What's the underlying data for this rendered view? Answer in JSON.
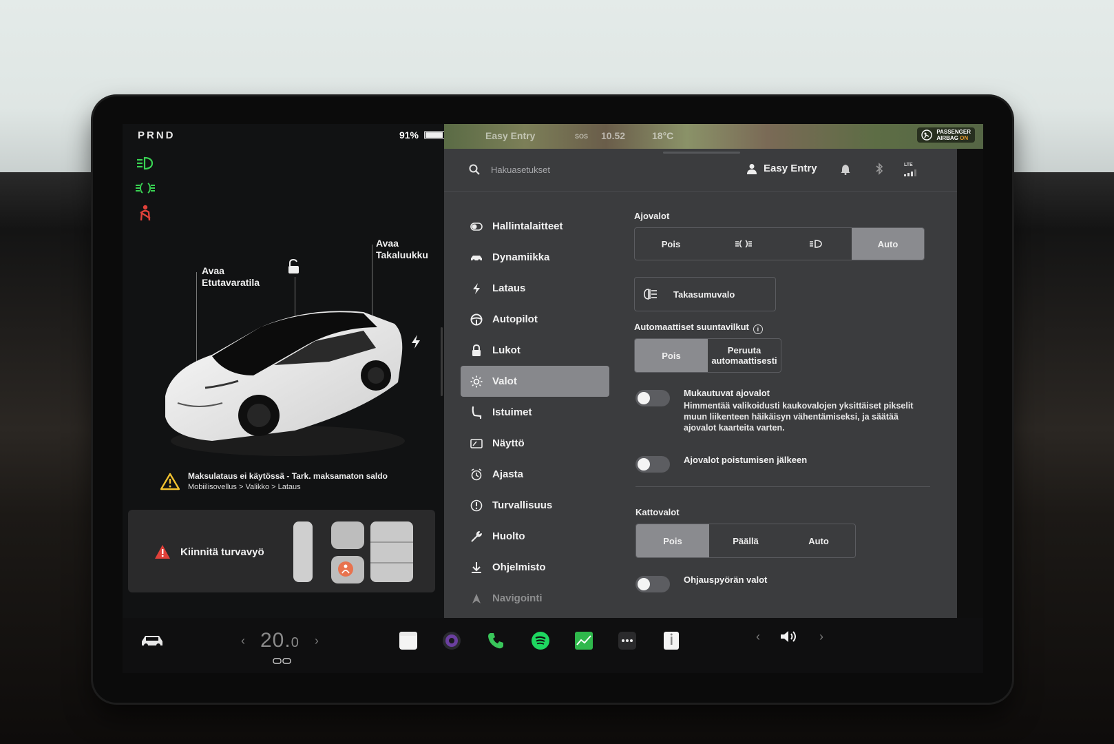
{
  "car": {
    "gear": "PRND",
    "battery": "91%",
    "battery_level": 0.91,
    "frunk_label_1": "Avaa",
    "frunk_label_2": "Etutavaratila",
    "trunk_label_1": "Avaa",
    "trunk_label_2": "Takaluukku",
    "notice_title": "Maksulataus ei käytössä - Tark. maksamaton saldo",
    "notice_path": "Mobiilisovellus > Valikko > Lataus",
    "seatbelt_alert": "Kiinnitä turvavyö"
  },
  "status_icons": [
    "headlight-icon",
    "parking-lights-icon",
    "seatbelt-warning-icon"
  ],
  "colors": {
    "indicator_green": "#39d353",
    "warning_red": "#e0413a",
    "warning_yellow": "#f2c230",
    "selected_segment": "#8a8b8f",
    "panel_bg": "#3b3c3e"
  },
  "topbar": {
    "map_profile": "Easy Entry",
    "map_sos": "SOS",
    "map_time": "10.52",
    "map_temp": "18°C",
    "airbag_line1": "PASSENGER",
    "airbag_line2": "AIRBAG",
    "airbag_state": "ON",
    "search_placeholder": "Hakuasetukset",
    "profile_name": "Easy Entry",
    "lte": "LTE"
  },
  "nav": {
    "items": [
      {
        "label": "Hallintalaitteet",
        "icon": "toggle-icon"
      },
      {
        "label": "Dynamiikka",
        "icon": "car-icon"
      },
      {
        "label": "Lataus",
        "icon": "bolt-icon"
      },
      {
        "label": "Autopilot",
        "icon": "steering-wheel-icon"
      },
      {
        "label": "Lukot",
        "icon": "lock-icon"
      },
      {
        "label": "Valot",
        "icon": "sun-icon"
      },
      {
        "label": "Istuimet",
        "icon": "seat-icon"
      },
      {
        "label": "Näyttö",
        "icon": "display-icon"
      },
      {
        "label": "Ajasta",
        "icon": "alarm-clock-icon"
      },
      {
        "label": "Turvallisuus",
        "icon": "info-circle-icon"
      },
      {
        "label": "Huolto",
        "icon": "wrench-icon"
      },
      {
        "label": "Ohjelmisto",
        "icon": "download-icon"
      },
      {
        "label": "Navigointi",
        "icon": "navigation-icon"
      }
    ],
    "active": "Valot"
  },
  "lights": {
    "headlights_title": "Ajovalot",
    "headlights_options": [
      "Pois",
      "",
      "",
      "Auto"
    ],
    "headlights_selected": "Auto",
    "rear_fog_label": "Takasumuvalo",
    "auto_turn_title": "Automaattiset suuntavilkut",
    "auto_turn_options": [
      "Pois",
      "Peruuta automaattisesti"
    ],
    "auto_turn_selected": "Pois",
    "adaptive_title": "Mukautuvat ajovalot",
    "adaptive_desc": "Himmentää valikoidusti kaukovalojen yksittäiset pikselit muun liikenteen häikäisyn vähentämiseksi, ja säätää ajovalot kaarteita varten.",
    "adaptive_on": false,
    "after_exit_label": "Ajovalot poistumisen jälkeen",
    "after_exit_on": false,
    "dome_title": "Kattovalot",
    "dome_options": [
      "Pois",
      "Päällä",
      "Auto"
    ],
    "dome_selected": "Pois",
    "steering_lights_label": "Ohjauspyörän valot",
    "steering_lights_on": false
  },
  "dock": {
    "temp_whole": "20.",
    "temp_decimal": "0",
    "apps": [
      "notes-icon",
      "camera-icon",
      "phone-icon",
      "spotify-icon",
      "stocks-icon",
      "more-icon",
      "manual-icon"
    ]
  }
}
